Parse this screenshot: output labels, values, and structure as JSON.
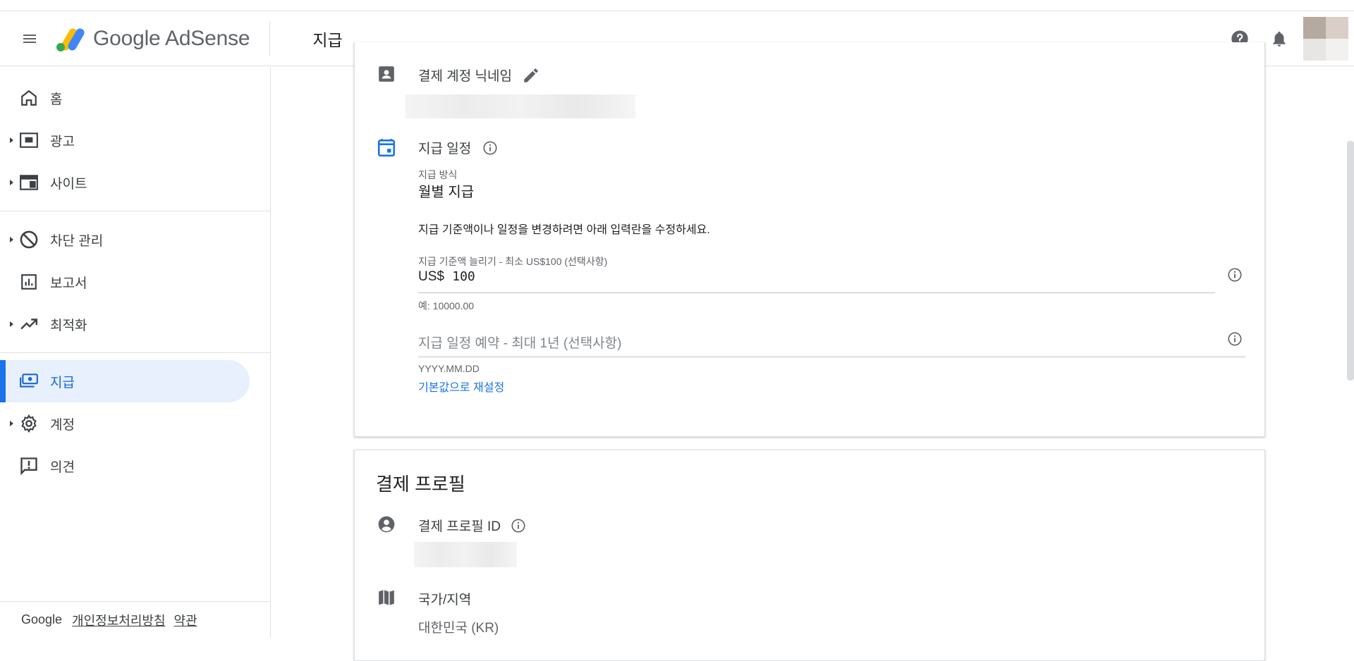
{
  "app": {
    "brand": "Google AdSense",
    "page_title": "지급"
  },
  "sidebar": {
    "items": [
      {
        "label": "홈",
        "icon": "home-icon",
        "expandable": false
      },
      {
        "label": "광고",
        "icon": "ads-icon",
        "expandable": true
      },
      {
        "label": "사이트",
        "icon": "sites-icon",
        "expandable": true
      },
      {
        "label": "차단 관리",
        "icon": "block-icon",
        "expandable": true
      },
      {
        "label": "보고서",
        "icon": "reports-icon",
        "expandable": false
      },
      {
        "label": "최적화",
        "icon": "optimize-icon",
        "expandable": true
      },
      {
        "label": "지급",
        "icon": "payments-icon",
        "expandable": false,
        "active": true
      },
      {
        "label": "계정",
        "icon": "gear-icon",
        "expandable": true
      },
      {
        "label": "의견",
        "icon": "feedback-icon",
        "expandable": false
      }
    ],
    "footer": {
      "brand": "Google",
      "privacy": "개인정보처리방침",
      "terms": "약관"
    }
  },
  "payment_settings": {
    "nickname_title": "결제 계정 닉네임",
    "schedule_title": "지급 일정",
    "method_label": "지급 방식",
    "method_value": "월별 지급",
    "description": "지급 기준액이나 일정을 변경하려면 아래 입력란을 수정하세요.",
    "threshold_label": "지급 기준액 늘리기 - 최소 US$100 (선택사항)",
    "threshold_prefix": "US$",
    "threshold_value": "100",
    "threshold_hint": "예: 10000.00",
    "schedule_placeholder": "지급 일정 예약 - 최대 1년 (선택사항)",
    "schedule_hint": "YYYY.MM.DD",
    "reset_link": "기본값으로 재설정"
  },
  "payment_profile": {
    "title": "결제 프로필",
    "id_label": "결제 프로필 ID",
    "country_label": "국가/지역",
    "country_value": "대한민국 (KR)"
  },
  "colors": {
    "accent": "#1a73e8",
    "active_bg": "#e8f0fe",
    "text": "#202124",
    "muted": "#5f6368"
  }
}
